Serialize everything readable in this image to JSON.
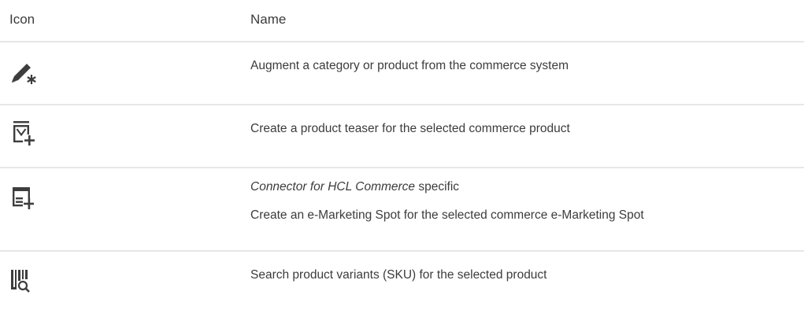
{
  "table": {
    "headers": {
      "icon": "Icon",
      "name": "Name"
    },
    "rows": [
      {
        "icon": "augment-pencil-icon",
        "description": "Augment a category or product from the commerce system"
      },
      {
        "icon": "product-teaser-add-icon",
        "description": "Create a product teaser for the selected commerce product"
      },
      {
        "icon": "emarketing-spot-add-icon",
        "note_italic": "Connector for HCL Commerce",
        "note_rest": " specific",
        "description": "Create an e-Marketing Spot for the selected commerce e-Marketing Spot"
      },
      {
        "icon": "barcode-search-icon",
        "description": "Search product variants (SKU) for the selected product"
      }
    ]
  },
  "colors": {
    "icon": "#3d3d3d",
    "divider": "#e7e7e7",
    "text": "#3c3c3c"
  }
}
